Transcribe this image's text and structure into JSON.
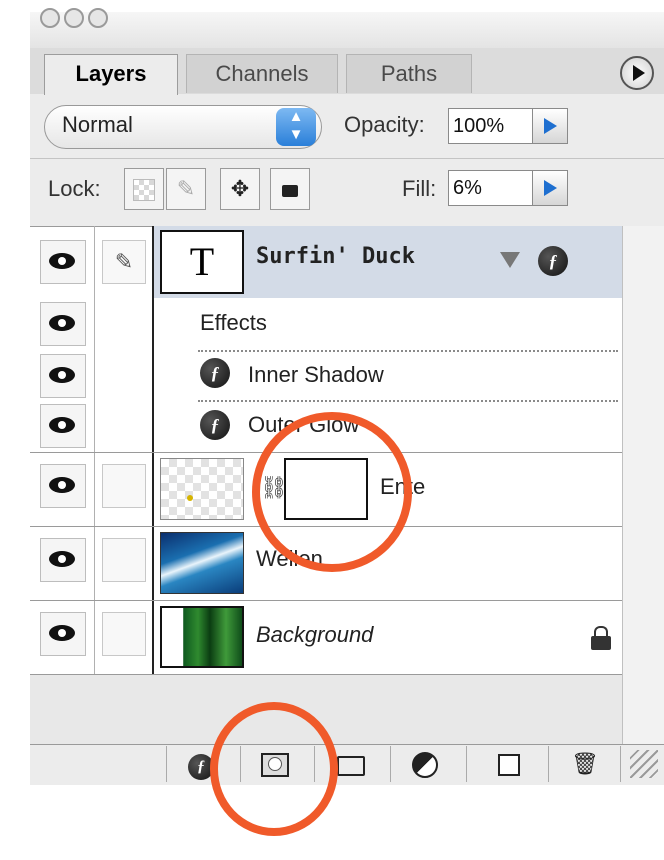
{
  "tabs": [
    "Layers",
    "Channels",
    "Paths"
  ],
  "blend_mode": "Normal",
  "opacity": {
    "label": "Opacity:",
    "value": "100%"
  },
  "lock": {
    "label": "Lock:"
  },
  "fill": {
    "label": "Fill:",
    "value": "6%"
  },
  "layers": [
    {
      "name": "Surfin' Duck",
      "thumb_letter": "T"
    },
    {
      "name": "Ente"
    },
    {
      "name": "Wellen"
    },
    {
      "name": "Background"
    }
  ],
  "effects": {
    "header": "Effects",
    "items": [
      "Inner Shadow",
      "Outer Glow"
    ]
  },
  "colors": {
    "accent": "#f05a2a",
    "selected_row": "#d3dbe7",
    "arrow_blue": "#2a7fd9"
  }
}
